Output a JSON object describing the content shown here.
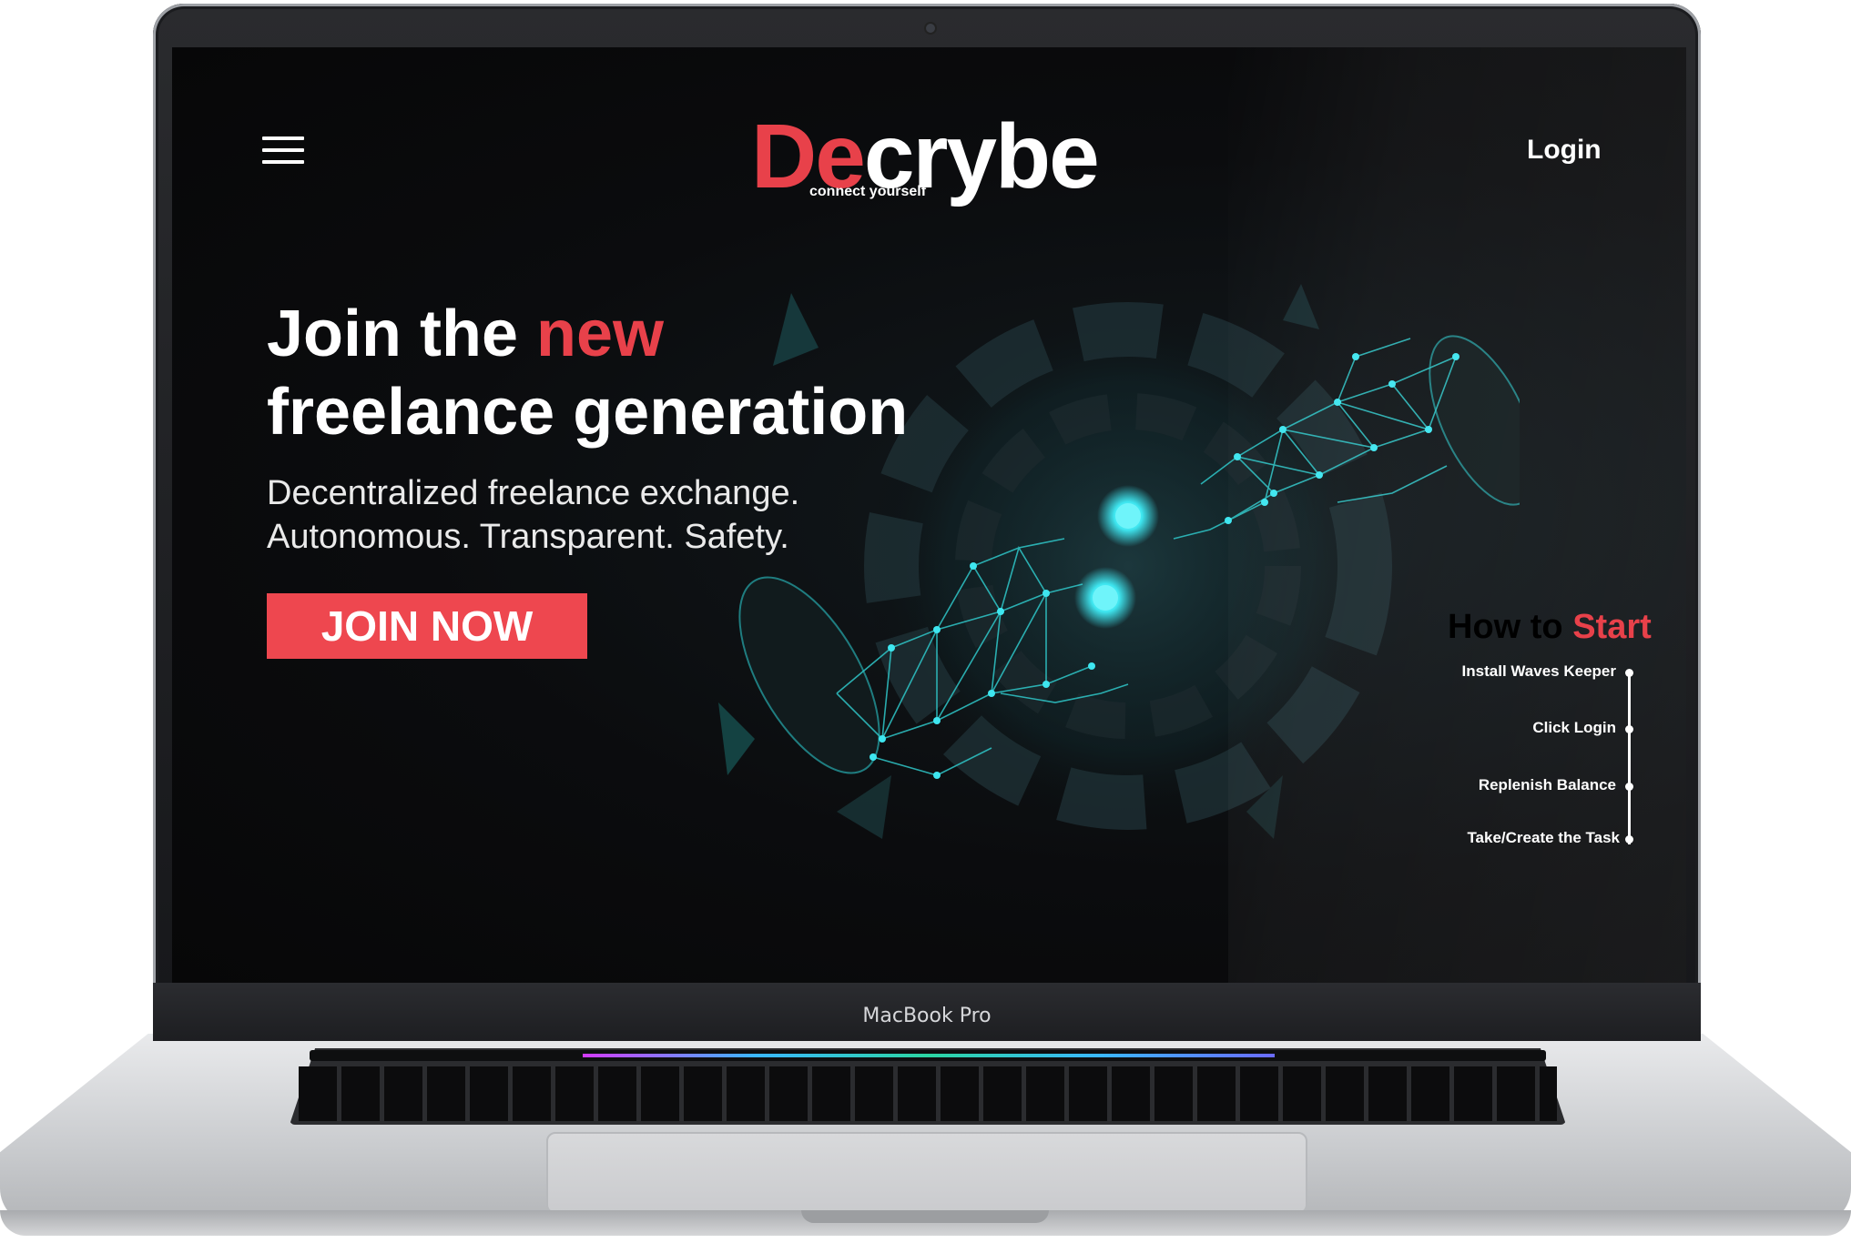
{
  "device": {
    "label": "MacBook Pro"
  },
  "header": {
    "menu_icon": "hamburger-menu-icon",
    "logo": {
      "word_red": "De",
      "word_white": "crybe",
      "tagline": "connect yourself"
    },
    "login_label": "Login"
  },
  "hero": {
    "headline_part1": "Join the ",
    "headline_accent": "new",
    "headline_line2": "freelance generation",
    "subline_1": "Decentralized freelance exchange.",
    "subline_2": "Autonomous. Transparent. Safety.",
    "cta_label": "JOIN NOW",
    "illustration_icon": "polygon-hands-icon"
  },
  "how_to_start": {
    "title_white": "How to ",
    "title_accent": "Start",
    "steps": [
      {
        "label": "Install Waves Keeper"
      },
      {
        "label": "Click Login"
      },
      {
        "label": "Replenish Balance"
      },
      {
        "label": "Take/Create the Task"
      }
    ]
  },
  "colors": {
    "accent": "#e8414a",
    "button": "#ee474f",
    "screen_bg": "#0b0c0e",
    "illustration": "#2fc7c9",
    "glow": "#3ee6f0"
  }
}
